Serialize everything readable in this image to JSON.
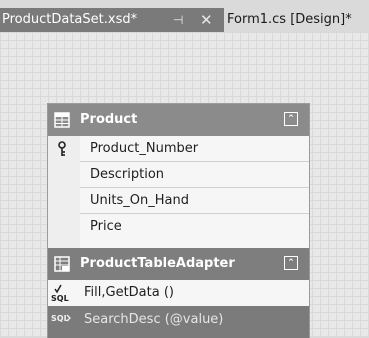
{
  "tabs": [
    {
      "label": "ProductDataSet.xsd*",
      "pin_glyph": "⊣",
      "close_glyph": "✕",
      "active": true
    },
    {
      "label": "Form1.cs [Design]*",
      "active": false
    }
  ],
  "table": {
    "title": "Product",
    "icon": "datatable-icon",
    "collapse_glyph": "⌃",
    "columns": [
      {
        "name": "Product_Number",
        "primary_key": true
      },
      {
        "name": "Description",
        "primary_key": false
      },
      {
        "name": "Units_On_Hand",
        "primary_key": false
      },
      {
        "name": "Price",
        "primary_key": false
      }
    ]
  },
  "adapter": {
    "title": "ProductTableAdapter",
    "icon": "tableadapter-icon",
    "collapse_glyph": "⌃",
    "queries": [
      {
        "label": "Fill,GetData ()",
        "icon": "sql-check-icon",
        "selected": false
      },
      {
        "label": "SearchDesc (@value)",
        "icon": "sql-icon",
        "selected": true
      }
    ]
  },
  "colors": {
    "header_bg": "#8b8b8b",
    "selected_row_bg": "#7b7b7b",
    "active_tab_bg": "#7a7a7a"
  }
}
